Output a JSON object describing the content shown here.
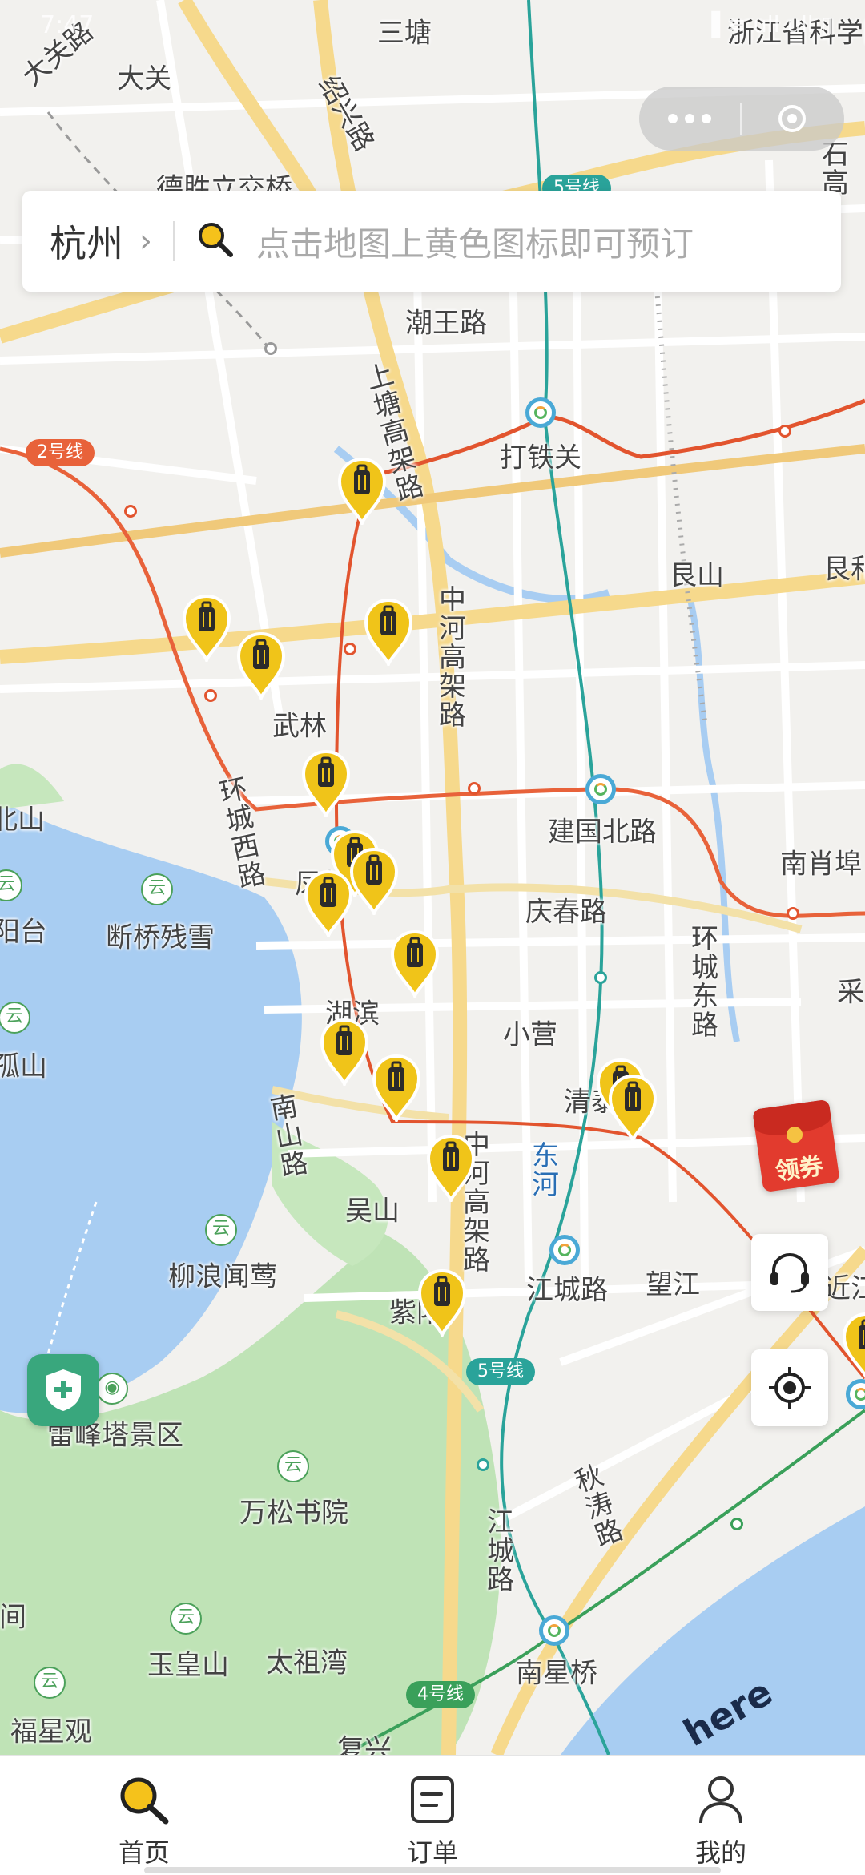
{
  "status_bar": {
    "time": "7:47",
    "icons": "▐ ≡ ull ull ▯"
  },
  "capsule": {
    "more_icon": "more-dots-icon",
    "close_icon": "close-target-icon"
  },
  "search": {
    "city": "杭州",
    "placeholder": "点击地图上黄色图标即可预订",
    "icon": "search-icon"
  },
  "map": {
    "labels": [
      {
        "text": "三塘"
      },
      {
        "text": "大关路"
      },
      {
        "text": "大关"
      },
      {
        "text": "绍兴路"
      },
      {
        "text": "浙江省科学院"
      },
      {
        "text": "德胜立交桥"
      },
      {
        "text": "石高"
      },
      {
        "text": "潮王路"
      },
      {
        "text": "上塘高架路"
      },
      {
        "text": "打铁关"
      },
      {
        "text": "艮山"
      },
      {
        "text": "艮和"
      },
      {
        "text": "中河高架路"
      },
      {
        "text": "武林"
      },
      {
        "text": "环城西路"
      },
      {
        "text": "北山"
      },
      {
        "text": "建国北路"
      },
      {
        "text": "南肖埠"
      },
      {
        "text": "凤起"
      },
      {
        "text": "断桥残雪"
      },
      {
        "text": "阳台"
      },
      {
        "text": "庆春路"
      },
      {
        "text": "环城东路"
      },
      {
        "text": "采"
      },
      {
        "text": "孤山"
      },
      {
        "text": "湖滨"
      },
      {
        "text": "小营"
      },
      {
        "text": "清泰"
      },
      {
        "text": "南山路"
      },
      {
        "text": "东河"
      },
      {
        "text": "吴山"
      },
      {
        "text": "中河高架路"
      },
      {
        "text": "柳浪闻莺"
      },
      {
        "text": "江城路"
      },
      {
        "text": "望江"
      },
      {
        "text": "近江"
      },
      {
        "text": "紫阳"
      },
      {
        "text": "雷峰塔景区"
      },
      {
        "text": "万松书院"
      },
      {
        "text": "秋涛路"
      },
      {
        "text": "江城路"
      },
      {
        "text": "间"
      },
      {
        "text": "玉皇山"
      },
      {
        "text": "太祖湾"
      },
      {
        "text": "南星桥"
      },
      {
        "text": "福星观"
      },
      {
        "text": "复兴"
      }
    ],
    "line_tags": [
      {
        "text": "2号线",
        "color": "#e8623a"
      },
      {
        "text": "5号线",
        "color": "#2aa39a"
      },
      {
        "text": "5号线",
        "color": "#2aa39a"
      },
      {
        "text": "4号线",
        "color": "#3aa05a"
      }
    ],
    "pin_icon": "luggage-pin-icon",
    "pin_color": "#f0c419",
    "here_logo": "here"
  },
  "floating": {
    "coupon_label": "领券",
    "support_icon": "headset-icon",
    "locate_icon": "locate-icon",
    "shield_icon": "shield-plus-icon"
  },
  "tabs": [
    {
      "label": "首页",
      "icon": "search-icon",
      "active": true
    },
    {
      "label": "订单",
      "icon": "order-icon",
      "active": false
    },
    {
      "label": "我的",
      "icon": "user-icon",
      "active": false
    }
  ]
}
